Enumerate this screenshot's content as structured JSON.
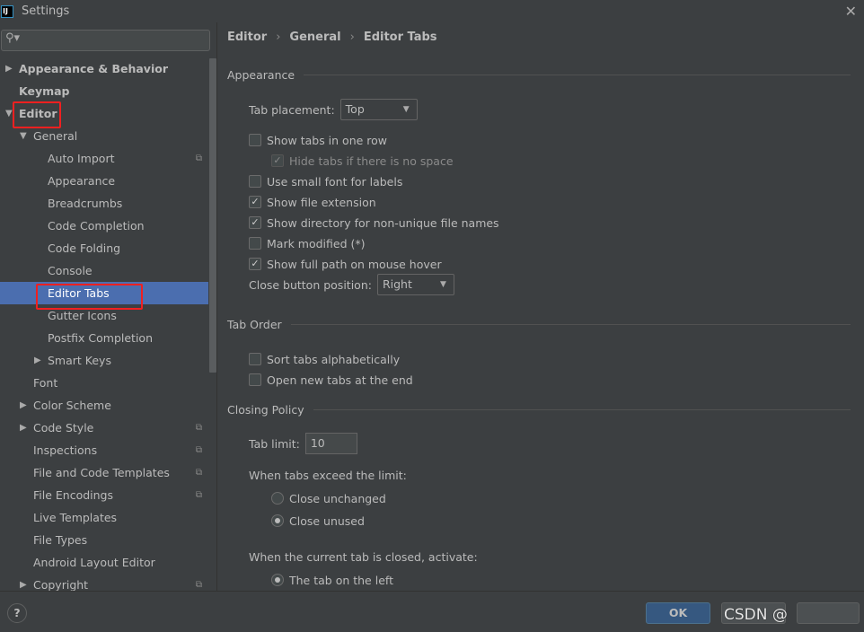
{
  "window": {
    "title": "Settings",
    "logo": "IJ"
  },
  "search": {
    "placeholder": ""
  },
  "sidebar": {
    "items": [
      {
        "label": "Appearance & Behavior",
        "level": 0,
        "arrow": "right",
        "bold": true
      },
      {
        "label": "Keymap",
        "level": 0,
        "bold": true
      },
      {
        "label": "Editor",
        "level": 0,
        "arrow": "down",
        "bold": true
      },
      {
        "label": "General",
        "level": 1,
        "arrow": "down"
      },
      {
        "label": "Auto Import",
        "level": 2,
        "copy": true
      },
      {
        "label": "Appearance",
        "level": 2
      },
      {
        "label": "Breadcrumbs",
        "level": 2
      },
      {
        "label": "Code Completion",
        "level": 2
      },
      {
        "label": "Code Folding",
        "level": 2
      },
      {
        "label": "Console",
        "level": 2
      },
      {
        "label": "Editor Tabs",
        "level": 2,
        "selected": true
      },
      {
        "label": "Gutter Icons",
        "level": 2
      },
      {
        "label": "Postfix Completion",
        "level": 2
      },
      {
        "label": "Smart Keys",
        "level": 2,
        "arrow": "right"
      },
      {
        "label": "Font",
        "level": 1
      },
      {
        "label": "Color Scheme",
        "level": 1,
        "arrow": "right"
      },
      {
        "label": "Code Style",
        "level": 1,
        "arrow": "right",
        "copy": true
      },
      {
        "label": "Inspections",
        "level": 1,
        "copy": true
      },
      {
        "label": "File and Code Templates",
        "level": 1,
        "copy": true
      },
      {
        "label": "File Encodings",
        "level": 1,
        "copy": true
      },
      {
        "label": "Live Templates",
        "level": 1
      },
      {
        "label": "File Types",
        "level": 1
      },
      {
        "label": "Android Layout Editor",
        "level": 1
      },
      {
        "label": "Copyright",
        "level": 1,
        "arrow": "right",
        "copy": true
      }
    ]
  },
  "breadcrumb": [
    "Editor",
    "General",
    "Editor Tabs"
  ],
  "appearance": {
    "title": "Appearance",
    "tab_placement_label": "Tab placement:",
    "tab_placement_value": "Top",
    "checks": [
      {
        "label": "Show tabs in one row",
        "checked": false
      },
      {
        "label": "Hide tabs if there is no space",
        "checked": true,
        "disabled": true
      },
      {
        "label": "Use small font for labels",
        "checked": false
      },
      {
        "label": "Show file extension",
        "checked": true
      },
      {
        "label": "Show directory for non-unique file names",
        "checked": true
      },
      {
        "label": "Mark modified (*)",
        "checked": false
      },
      {
        "label": "Show full path on mouse hover",
        "checked": true
      }
    ],
    "close_button_label": "Close button position:",
    "close_button_value": "Right"
  },
  "tab_order": {
    "title": "Tab Order",
    "checks": [
      {
        "label": "Sort tabs alphabetically",
        "checked": false
      },
      {
        "label": "Open new tabs at the end",
        "checked": false
      }
    ]
  },
  "closing_policy": {
    "title": "Closing Policy",
    "tab_limit_label": "Tab limit:",
    "tab_limit_value": "10",
    "exceed_label": "When tabs exceed the limit:",
    "exceed_options": [
      {
        "label": "Close unchanged",
        "selected": false
      },
      {
        "label": "Close unused",
        "selected": true
      }
    ],
    "activate_label": "When the current tab is closed, activate:",
    "activate_options": [
      {
        "label": "The tab on the left",
        "selected": true
      }
    ]
  },
  "footer": {
    "help": "?",
    "ok": "OK",
    "watermark": "CSDN @"
  },
  "colors": {
    "selection": "#4b6eaf",
    "background": "#3c3f41",
    "ok_button": "#365880",
    "highlight": "#f02020"
  }
}
